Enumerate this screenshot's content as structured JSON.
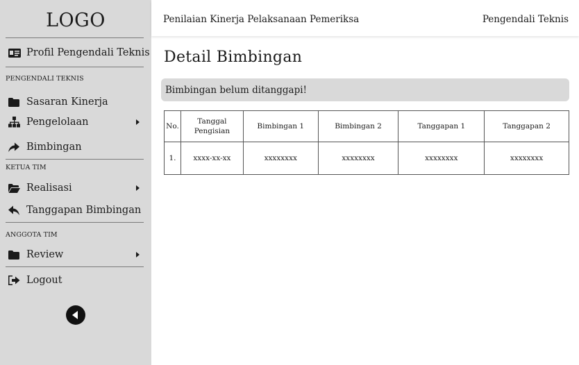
{
  "sidebar": {
    "logo": "LOGO",
    "profile_label": "Profil Pengendali Teknis",
    "section_pengendali": "PENGENDALI TEKNIS",
    "sasaran_label": "Sasaran Kinerja",
    "pengelolaan_label": "Pengelolaan",
    "bimbingan_label": "Bimbingan",
    "section_ketua": "KETUA TIM",
    "realisasi_label": "Realisasi",
    "tanggapan_label": "Tanggapan Bimbingan",
    "section_anggota": "ANGGOTA TIM",
    "review_label": "Review",
    "logout_label": "Logout",
    "back_icon": "circle-arrow-left-icon"
  },
  "header": {
    "title": "Penilaian Kinerja Pelaksanaan Pemeriksa",
    "role": "Pengendali Teknis"
  },
  "main": {
    "page_title": "Detail Bimbingan",
    "alert": "Bimbingan belum ditanggapi!",
    "table": {
      "headers": [
        "No.",
        "Tanggal Pengisian",
        "Bimbingan 1",
        "Bimbingan 2",
        "Tanggapan 1",
        "Tanggapan 2"
      ],
      "rows": [
        [
          "1.",
          "xxxx-xx-xx",
          "xxxxxxxx",
          "xxxxxxxx",
          "xxxxxxxx",
          "xxxxxxxx"
        ]
      ]
    }
  },
  "colors": {
    "sidebar_bg": "#d9d9d9",
    "alert_bg": "#d9d9d9",
    "text": "#1a1a1a"
  }
}
